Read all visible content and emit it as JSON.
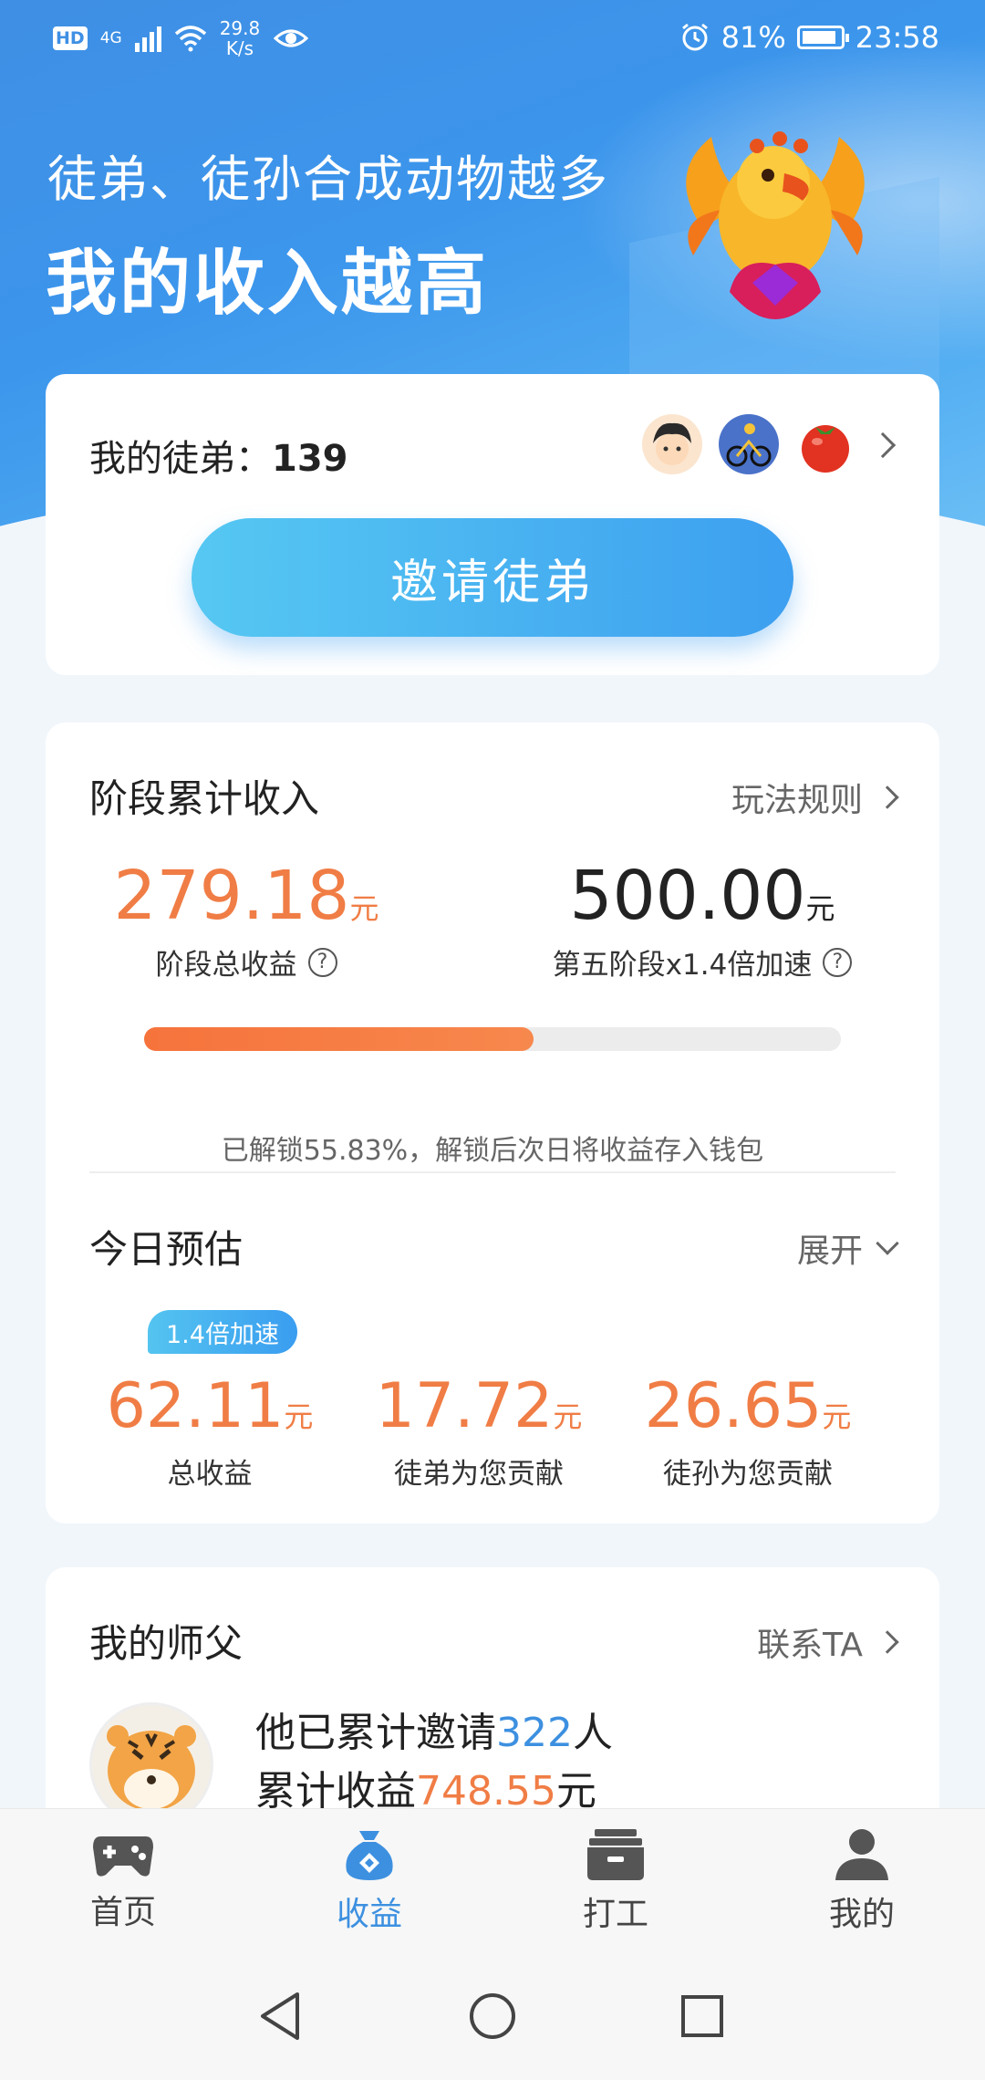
{
  "status_bar": {
    "hd": "HD",
    "network": "4G",
    "speed_value": "29.8",
    "speed_unit": "K/s",
    "battery": "81%",
    "time": "23:58"
  },
  "hero": {
    "subtitle": "徒弟、徒孙合成动物越多",
    "title": "我的收入越高"
  },
  "disciples": {
    "label": "我的徒弟：",
    "count": "139",
    "invite_button": "邀请徒弟"
  },
  "stage": {
    "title": "阶段累计收入",
    "rules_link": "玩法规则",
    "total_value": "279.18",
    "total_unit": "元",
    "total_label": "阶段总收益",
    "target_value": "500.00",
    "target_unit": "元",
    "target_label": "第五阶段x1.4倍加速",
    "progress_percent": 55.83,
    "note": "已解锁55.83%，解锁后次日将收益存入钱包"
  },
  "today": {
    "title": "今日预估",
    "expand_link": "展开",
    "boost_badge": "1.4倍加速",
    "stats": [
      {
        "value": "62.11",
        "unit": "元",
        "label": "总收益"
      },
      {
        "value": "17.72",
        "unit": "元",
        "label": "徒弟为您贡献"
      },
      {
        "value": "26.65",
        "unit": "元",
        "label": "徒孙为您贡献"
      }
    ]
  },
  "mentor": {
    "title": "我的师父",
    "contact_link": "联系TA",
    "invited_prefix": "他已累计邀请",
    "invited_count": "322",
    "invited_suffix": "人",
    "earnings_prefix": "累计收益",
    "earnings_value": "748.55",
    "earnings_suffix": "元"
  },
  "tabs": [
    {
      "label": "首页",
      "icon": "gamepad-icon"
    },
    {
      "label": "收益",
      "icon": "money-bag-icon",
      "active": true
    },
    {
      "label": "打工",
      "icon": "briefcase-icon"
    },
    {
      "label": "我的",
      "icon": "user-icon"
    }
  ],
  "colors": {
    "accent_blue": "#3d90e0",
    "accent_orange": "#f07d45",
    "hero_blue": "#3f8fe4"
  }
}
